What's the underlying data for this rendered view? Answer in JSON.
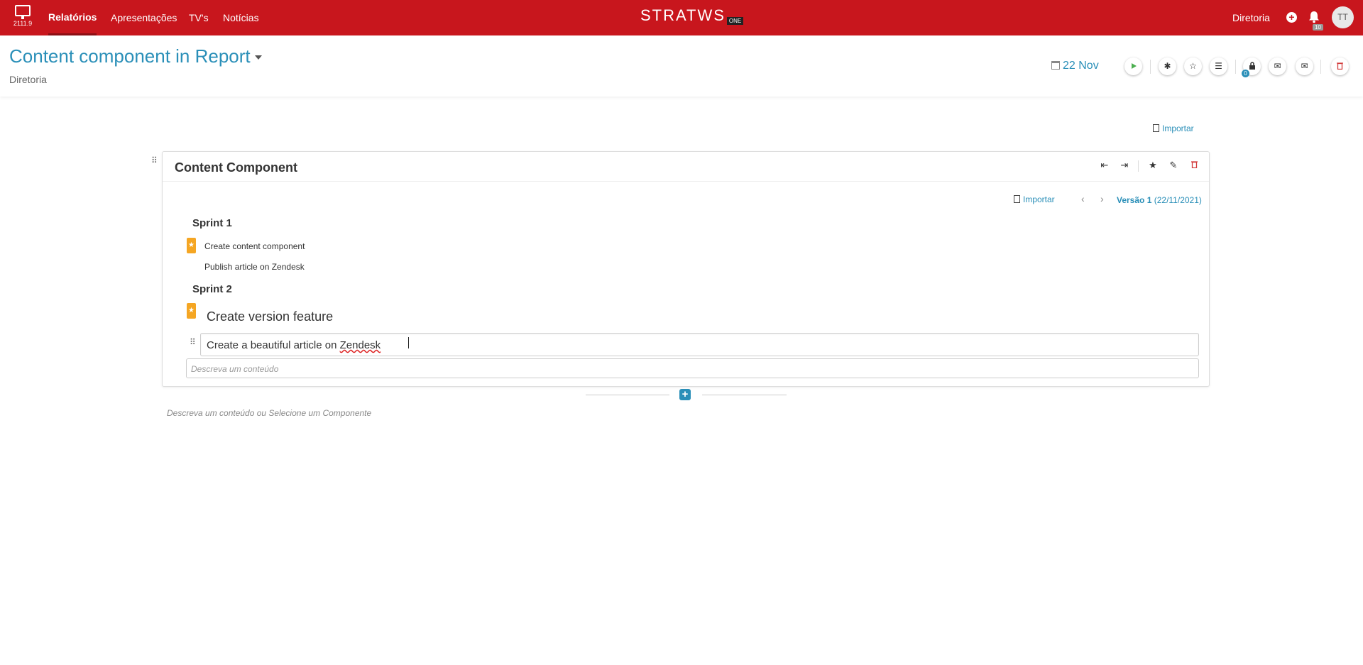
{
  "nav": {
    "version": "2111.9",
    "items": [
      {
        "label": "Relatórios"
      },
      {
        "label": "Apresentações"
      },
      {
        "label": "TV's"
      },
      {
        "label": "Notícias"
      }
    ],
    "logo": "STRATWS",
    "logo_badge": "ONE",
    "org": "Diretoria",
    "notifications": "10",
    "avatar": "TT",
    "brand_color": "#c8161d"
  },
  "header": {
    "title": "Content component in Report",
    "subtitle": "Diretoria",
    "date": "22 Nov",
    "lock_count": "0"
  },
  "import_top": "Importar",
  "component": {
    "title": "Content Component",
    "import_label": "Importar",
    "version_label": "Versão 1",
    "version_date": "(22/11/2021)",
    "sections": [
      {
        "heading": "Sprint 1",
        "items": [
          "Create content component",
          "Publish article on Zendesk"
        ]
      },
      {
        "heading": "Sprint 2",
        "items": [
          "Create version feature"
        ]
      }
    ],
    "editing_text_start": "Create a beautiful article on ",
    "editing_text_end": "Zendesk",
    "input_placeholder": "Descreva um conteúdo"
  },
  "footer_placeholder": "Descreva um conteúdo ou Selecione um Componente",
  "accent_color": "#2a8fb8",
  "star_color": "#f5a623"
}
